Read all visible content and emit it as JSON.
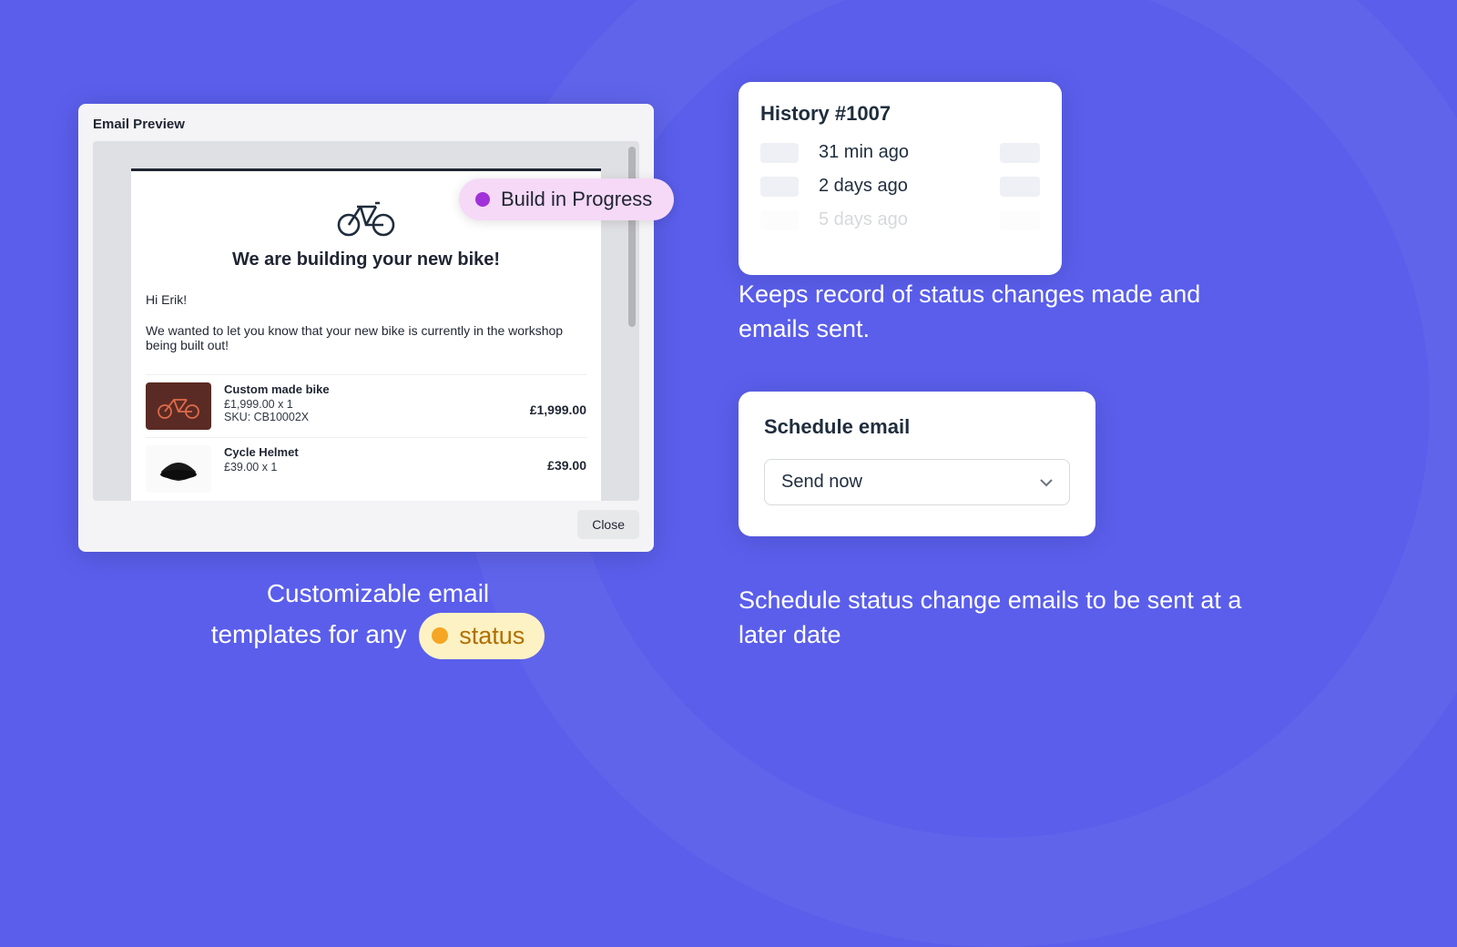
{
  "preview": {
    "title": "Email Preview",
    "email": {
      "heading": "We are building your new bike!",
      "greeting": "Hi Erik!",
      "body": "We wanted to let you know that your new bike is currently in the workshop being built out!",
      "items": [
        {
          "name": "Custom made bike",
          "price_qty": "£1,999.00 x 1",
          "sku": "SKU: CB10002X",
          "line_total": "£1,999.00"
        },
        {
          "name": "Cycle Helmet",
          "price_qty": "£39.00 x 1",
          "sku": "",
          "line_total": "£39.00"
        }
      ]
    },
    "close_label": "Close"
  },
  "progress_badge": {
    "label": "Build in Progress",
    "dot_color": "#a132d9"
  },
  "caption_left": {
    "line1": "Customizable email",
    "line2_prefix": "templates for any",
    "status_pill": "status"
  },
  "history": {
    "title": "History #1007",
    "rows": [
      "31 min ago",
      "2 days ago",
      "5 days ago"
    ]
  },
  "history_caption": "Keeps record of status changes made and emails sent.",
  "schedule": {
    "title": "Schedule email",
    "selected": "Send now"
  },
  "schedule_caption": "Schedule status change emails to be sent at a later date"
}
